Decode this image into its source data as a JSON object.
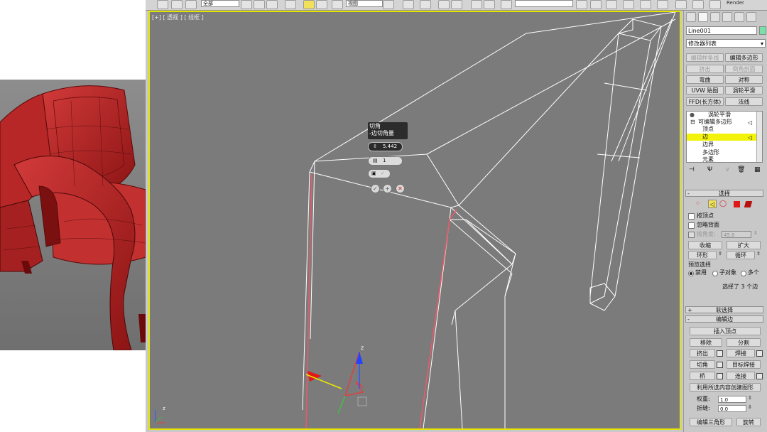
{
  "viewport": {
    "label": "[+] [ 透视 ] [ 线框 ]"
  },
  "toolbar": {
    "selection_set": "全部",
    "view_field": "视图",
    "render_label": "Render"
  },
  "caddy": {
    "title": "切角",
    "subtitle": "-边切角量",
    "amount_value": "5.442",
    "segments_value": "1"
  },
  "command_panel": {
    "object_name": "Line001",
    "modifier_list": "修改器列表",
    "object_color": "#7be0a8",
    "modifier_buttons": [
      {
        "label": "编辑样条线",
        "enabled": false
      },
      {
        "label": "编辑多边形",
        "enabled": true
      },
      {
        "label": "挤出",
        "enabled": false
      },
      {
        "label": "倒角剖面",
        "enabled": false
      },
      {
        "label": "弯曲",
        "enabled": true
      },
      {
        "label": "对称",
        "enabled": true
      },
      {
        "label": "UVW 贴图",
        "enabled": true
      },
      {
        "label": "涡轮平滑",
        "enabled": true
      },
      {
        "label": "FFD(长方体)",
        "enabled": true
      },
      {
        "label": "法线",
        "enabled": true
      }
    ],
    "stack": [
      {
        "label": "涡轮平滑",
        "indent": 2,
        "selected": false
      },
      {
        "label": "可编辑多边形",
        "indent": 1,
        "selected": false
      },
      {
        "label": "顶点",
        "indent": 3,
        "selected": false
      },
      {
        "label": "边",
        "indent": 3,
        "selected": true
      },
      {
        "label": "边界",
        "indent": 3,
        "selected": false
      },
      {
        "label": "多边形",
        "indent": 3,
        "selected": false
      },
      {
        "label": "元素",
        "indent": 3,
        "selected": false
      }
    ],
    "selection": {
      "title": "选择",
      "by_vertex": "按顶点",
      "ignore_backfacing": "忽略背面",
      "by_angle": "按角度:",
      "angle_value": "45.0",
      "shrink": "收缩",
      "grow": "扩大",
      "ring": "环形",
      "loop": "循环",
      "preview_title": "预览选择",
      "preview_off": "禁用",
      "preview_subobj": "子对象",
      "preview_multi": "多个",
      "status": "选择了 3 个边"
    },
    "soft_selection": "软选择",
    "edit_edges": {
      "title": "编辑边",
      "insert_vertex": "插入顶点",
      "remove": "移除",
      "split": "分割",
      "extrude": "挤出",
      "weld": "焊接",
      "chamfer": "切角",
      "target_weld": "目标焊接",
      "bridge": "桥",
      "connect": "连接",
      "create_shape": "利用所选内容创建图形",
      "weight_label": "权重:",
      "weight_value": "1.0",
      "crease_label": "折缝:",
      "crease_value": "0.0",
      "edit_tri": "编辑三角形",
      "turn": "旋转"
    }
  }
}
